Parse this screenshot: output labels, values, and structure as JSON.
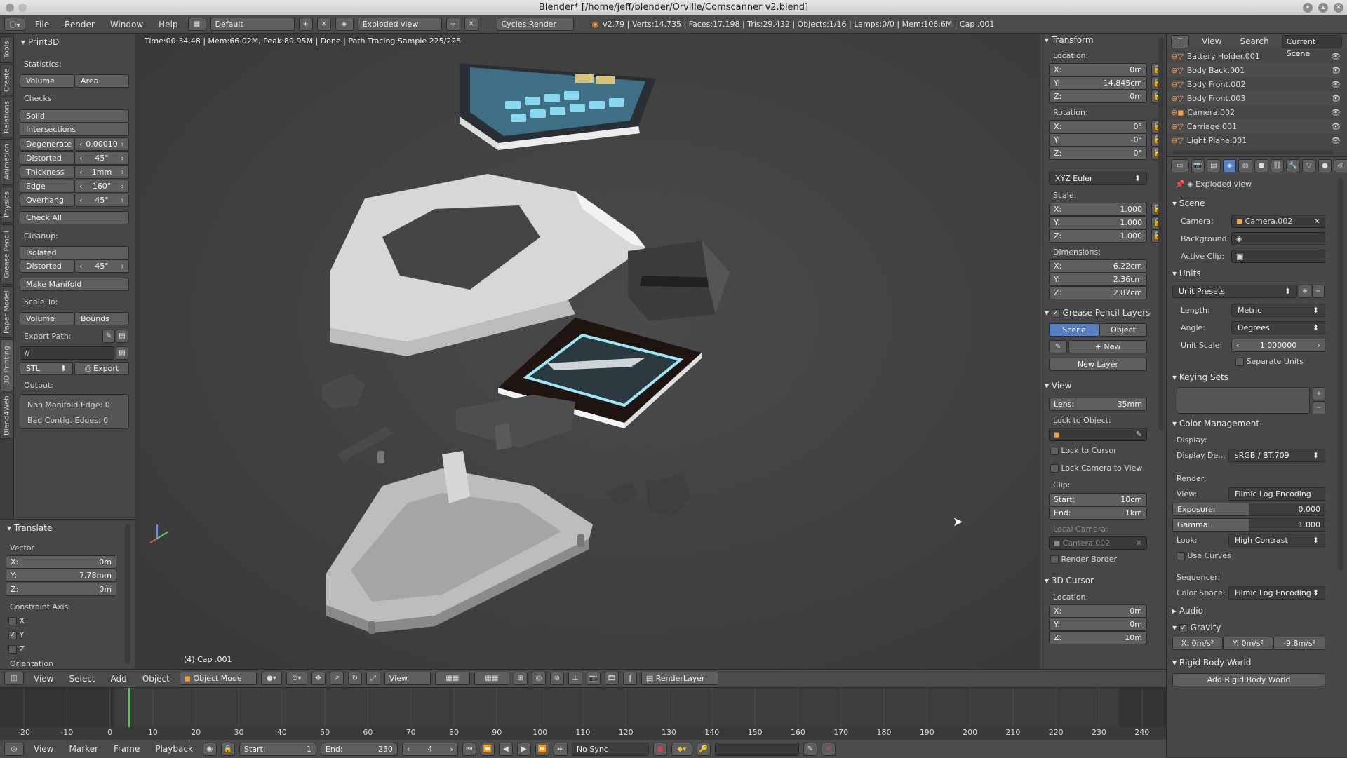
{
  "window": {
    "title": "Blender* [/home/jeff/blender/Orville/Comscanner v2.blend]"
  },
  "infobar": {
    "menus": [
      "File",
      "Render",
      "Window",
      "Help"
    ],
    "layout": "Default",
    "scene": "Exploded view",
    "engine": "Cycles Render",
    "stats": "v2.79 | Verts:14,735 | Faces:17,198 | Tris:29,432 | Objects:1/16 | Lamps:0/0 | Mem:106.6M | Cap .001"
  },
  "tabs": [
    "Tools",
    "Create",
    "Relations",
    "Animation",
    "Physics",
    "Grease Pencil",
    "Paper Model",
    "3D Printing",
    "Blend4Web"
  ],
  "print3d": {
    "title": "Print3D",
    "statistics_label": "Statistics:",
    "volume": "Volume",
    "area": "Area",
    "checks_label": "Checks:",
    "solid": "Solid",
    "intersections": "Intersections",
    "rows": [
      {
        "label": "Degenerate",
        "value": "0.00010"
      },
      {
        "label": "Distorted",
        "value": "45°"
      },
      {
        "label": "Thickness",
        "value": "1mm"
      },
      {
        "label": "Edge Sharp",
        "value": "160°"
      },
      {
        "label": "Overhang",
        "value": "45°"
      }
    ],
    "check_all": "Check All",
    "cleanup_label": "Cleanup:",
    "isolated": "Isolated",
    "distorted2": {
      "label": "Distorted",
      "value": "45°"
    },
    "make_manifold": "Make Manifold",
    "scale_to_label": "Scale To:",
    "scale_volume": "Volume",
    "scale_bounds": "Bounds",
    "export_path_label": "Export Path:",
    "export_path": "//",
    "format": "STL",
    "export": "Export",
    "output_label": "Output:",
    "non_manifold": "Non Manifold Edge: 0",
    "bad_contig": "Bad Contig. Edges: 0"
  },
  "translate": {
    "title": "Translate",
    "vector_label": "Vector",
    "x": {
      "label": "X:",
      "value": "0m"
    },
    "y": {
      "label": "Y:",
      "value": "7.78mm"
    },
    "z": {
      "label": "Z:",
      "value": "0m"
    },
    "constraint_label": "Constraint Axis",
    "cx": "X",
    "cy": "Y",
    "cz": "Z",
    "orientation_label": "Orientation"
  },
  "viewport": {
    "status": "Time:00:34.48 | Mem:66.02M, Peak:89.95M | Done | Path Tracing Sample 225/225",
    "object_label": "(4) Cap .001"
  },
  "transform": {
    "title": "Transform",
    "location_label": "Location:",
    "loc": [
      {
        "label": "X:",
        "value": "0m"
      },
      {
        "label": "Y:",
        "value": "14.845cm"
      },
      {
        "label": "Z:",
        "value": "0m"
      }
    ],
    "rotation_label": "Rotation:",
    "rot": [
      {
        "label": "X:",
        "value": "0°"
      },
      {
        "label": "Y:",
        "value": "-0°"
      },
      {
        "label": "Z:",
        "value": "0°"
      }
    ],
    "rotation_mode": "XYZ Euler",
    "scale_label": "Scale:",
    "scale": [
      {
        "label": "X:",
        "value": "1.000"
      },
      {
        "label": "Y:",
        "value": "1.000"
      },
      {
        "label": "Z:",
        "value": "1.000"
      }
    ],
    "dimensions_label": "Dimensions:",
    "dims": [
      {
        "label": "X:",
        "value": "6.22cm"
      },
      {
        "label": "Y:",
        "value": "2.36cm"
      },
      {
        "label": "Z:",
        "value": "2.87cm"
      }
    ]
  },
  "grease": {
    "title": "Grease Pencil Layers",
    "scene": "Scene",
    "object": "Object",
    "new": "New",
    "new_layer": "New Layer"
  },
  "view": {
    "title": "View",
    "lens": {
      "label": "Lens:",
      "value": "35mm"
    },
    "lock_object_label": "Lock to Object:",
    "lock_cursor": "Lock to Cursor",
    "lock_camera": "Lock Camera to View",
    "clip_label": "Clip:",
    "clip_start": {
      "label": "Start:",
      "value": "10cm"
    },
    "clip_end": {
      "label": "End:",
      "value": "1km"
    },
    "local_camera_label": "Local Camera:",
    "local_camera": "Camera.002",
    "render_border": "Render Border"
  },
  "cursor": {
    "title": "3D Cursor",
    "location_label": "Location:",
    "loc": [
      {
        "label": "X:",
        "value": "0m"
      },
      {
        "label": "Y:",
        "value": "0m"
      },
      {
        "label": "Z:",
        "value": "10m"
      }
    ]
  },
  "outliner": {
    "menus": [
      "View",
      "Search"
    ],
    "scene": "Current Scene",
    "items": [
      "Battery Holder.001",
      "Body Back.001",
      "Body Front.002",
      "Body Front.003",
      "Camera.002",
      "Carriage.001",
      "Light Plane.001"
    ]
  },
  "props": {
    "context": "Exploded view",
    "scene_title": "Scene",
    "camera_label": "Camera:",
    "camera": "Camera.002",
    "background_label": "Background:",
    "clip_label": "Active Clip:",
    "units_title": "Units",
    "unit_presets": "Unit Presets",
    "length_label": "Length:",
    "length": "Metric",
    "angle_label": "Angle:",
    "angle": "Degrees",
    "unit_scale_label": "Unit Scale:",
    "unit_scale": "1.000000",
    "separate_units": "Separate Units",
    "keying_title": "Keying Sets",
    "color_title": "Color Management",
    "display_label": "Display:",
    "display_dev_label": "Display De...",
    "display_dev": "sRGB / BT.709",
    "render_label": "Render:",
    "view_label": "View:",
    "view": "Filmic Log Encoding Ba",
    "exposure_label": "Exposure:",
    "exposure": "0.000",
    "gamma_label": "Gamma:",
    "gamma": "1.000",
    "look_label": "Look:",
    "look": "High Contrast",
    "use_curves": "Use Curves",
    "sequencer_label": "Sequencer:",
    "colorspace_label": "Color Space:",
    "colorspace": "Filmic Log Encoding",
    "audio_title": "Audio",
    "gravity_title": "Gravity",
    "gx": "X: 0m/s²",
    "gy": "Y: 0m/s²",
    "gz": "-9.8m/s²",
    "rigid_title": "Rigid Body World",
    "add_rigid": "Add Rigid Body World"
  },
  "vheader": {
    "menus": [
      "View",
      "Select",
      "Add",
      "Object"
    ],
    "mode": "Object Mode",
    "view": "View",
    "render_layer": "RenderLayer"
  },
  "timeline": {
    "ticks": [
      "-20",
      "-10",
      "0",
      "10",
      "20",
      "30",
      "40",
      "50",
      "60",
      "70",
      "80",
      "90",
      "100",
      "110",
      "120",
      "130",
      "140",
      "150",
      "160",
      "170",
      "180",
      "190",
      "200",
      "210",
      "220",
      "230",
      "240"
    ],
    "menus": [
      "View",
      "Marker",
      "Frame",
      "Playback"
    ],
    "start": {
      "label": "Start:",
      "value": "1"
    },
    "end": {
      "label": "End:",
      "value": "250"
    },
    "current": "4",
    "sync": "No Sync"
  }
}
